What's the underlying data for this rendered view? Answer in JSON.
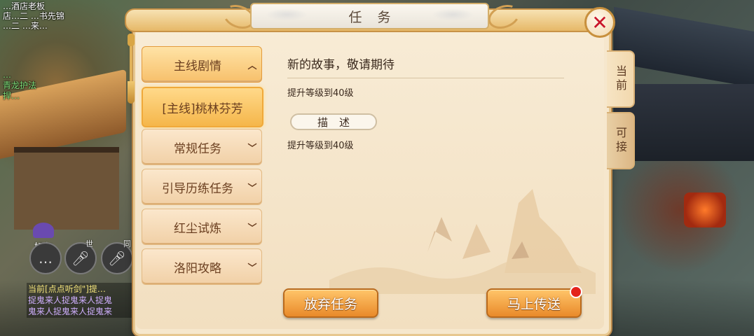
{
  "window": {
    "title": "任务",
    "close_icon": "close-icon"
  },
  "hud": {
    "top_lines": [
      "…酒店老板",
      "店…二 …书先锦",
      "…二 …来…"
    ],
    "mid_lines": [
      "…",
      "青龙护法",
      "捍…"
    ],
    "friend_label": "好友",
    "voice_tags": [
      "世",
      "同"
    ],
    "chat_lines": [
      {
        "prefix": "当前",
        "text": "[点点听剑\"]提…"
      },
      {
        "prefix": "",
        "text": "捉鬼来人捉鬼来人捉鬼"
      },
      {
        "prefix": "",
        "text": "鬼来人捉鬼来人捉鬼来"
      }
    ]
  },
  "sidebar": {
    "categories": [
      {
        "label": "主线剧情",
        "chevron": "chevron-up-icon",
        "expanded": true
      },
      {
        "label": "常规任务",
        "chevron": "chevron-down-icon"
      },
      {
        "label": "引导历练任务",
        "chevron": "chevron-down-icon"
      },
      {
        "label": "红尘试炼",
        "chevron": "chevron-down-icon"
      },
      {
        "label": "洛阳攻略",
        "chevron": "chevron-down-icon"
      }
    ],
    "selected_subitem": "[主线]桃林芬芳"
  },
  "content": {
    "story_title": "新的故事，敬请期待",
    "requirement": "提升等级到40级",
    "description_header": "描述",
    "description_text": "提升等级到40级"
  },
  "buttons": {
    "abandon": "放弃任务",
    "teleport": "马上传送"
  },
  "right_tabs": {
    "current": "当前",
    "available": "可接"
  },
  "colors": {
    "accent": "#f5b64a",
    "button": "#e98a2a",
    "close": "#c9152b",
    "notification": "#e4241c"
  }
}
